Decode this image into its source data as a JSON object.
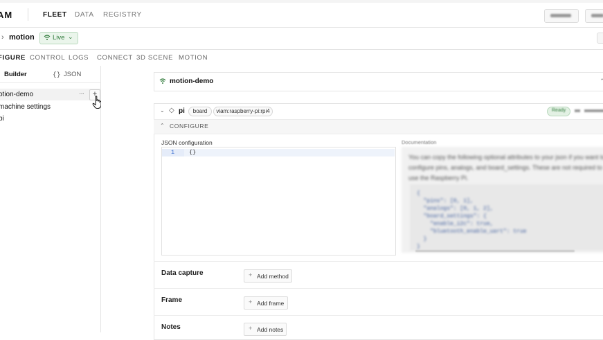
{
  "nav": {
    "logo": "AM",
    "links": [
      "FLEET",
      "DATA",
      "REGISTRY"
    ],
    "active": "FLEET"
  },
  "machine": {
    "name": "motion",
    "status": "Live"
  },
  "tabs": [
    "FIGURE",
    "CONTROL",
    "LOGS",
    "CONNECT",
    "3D SCENE",
    "MOTION"
  ],
  "active_tab": "FIGURE",
  "sidebar": {
    "tab_builder": "Builder",
    "tab_json_icon": "{}",
    "tab_json": "JSON",
    "items": [
      "otion-demo",
      "machine settings",
      "pi"
    ],
    "more": "···",
    "add": "+"
  },
  "machine_card": {
    "title": "motion-demo"
  },
  "component": {
    "name": "pi",
    "type": "board",
    "model": "viam:raspberry-pi:rpi4",
    "configure_label": "CONFIGURE",
    "json_label": "JSON configuration",
    "line_number": "1",
    "json_value": "{}",
    "doc_label": "Documentation",
    "doc_text": "You can copy the following optional attributes to your json if you want to configure pins, analogs, and board_settings. These are not required to use the Raspberry Pi.",
    "doc_code": "{\n  \"pins\": [0, 1],\n  \"analogs\": [0, 1, 2],\n  \"board_settings\": {\n    \"enable_i2c\": true,\n    \"bluetooth_enable_uart\": true\n  }\n}"
  },
  "sections": [
    {
      "label": "Data capture",
      "button": "Add method"
    },
    {
      "label": "Frame",
      "button": "Add frame"
    },
    {
      "label": "Notes",
      "button": "Add notes"
    }
  ],
  "colors": {
    "live_green": "#2f7a3a",
    "live_bg": "#eaf5eb",
    "line_number_blue": "#3a6fd0"
  }
}
